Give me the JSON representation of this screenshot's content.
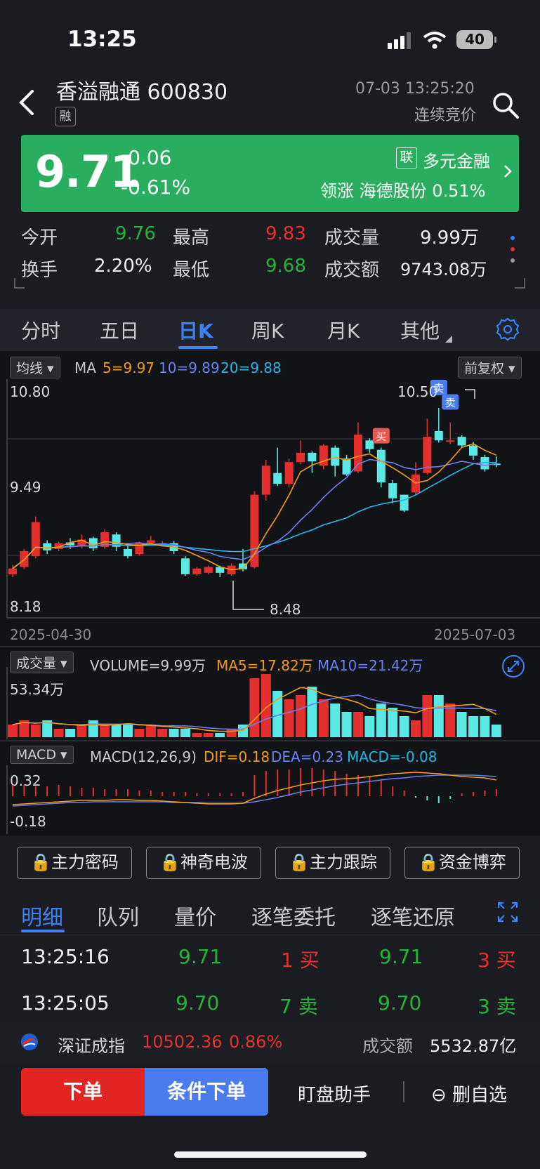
{
  "status_bar": {
    "time": "13:25",
    "battery": "40"
  },
  "header": {
    "stock_title": "香溢融通 600830",
    "margin_badge": "融",
    "datetime": "07-03 13:25:20",
    "trading_status": "连续竞价"
  },
  "quote": {
    "price": "9.71",
    "change": "-0.06",
    "change_pct": "-0.61%",
    "related_badge": "联",
    "related_sector": "多元金融",
    "leader_text": "领涨 海德股份 0.51%"
  },
  "stats": [
    {
      "label": "今开",
      "value": "9.76",
      "color": "green"
    },
    {
      "label": "最高",
      "value": "9.83",
      "color": "red"
    },
    {
      "label": "成交量",
      "value": "9.99万",
      "color": "white"
    },
    {
      "label": "换手",
      "value": "2.20%",
      "color": "white"
    },
    {
      "label": "最低",
      "value": "9.68",
      "color": "green"
    },
    {
      "label": "成交额",
      "value": "9743.08万",
      "color": "white"
    }
  ],
  "period_tabs": [
    "分时",
    "五日",
    "日K",
    "周K",
    "月K",
    "其他"
  ],
  "active_period": "日K",
  "kline": {
    "ma_button": "均线",
    "ma_label": "MA",
    "ma5": "5=9.97",
    "ma10": "10=9.89",
    "ma20": "20=9.88",
    "adjust_button": "前复权",
    "y_high": "10.80",
    "y_mid": "9.49",
    "y_low": "8.18",
    "max_label": "10.50",
    "min_label": "8.48",
    "start_date": "2025-04-30",
    "end_date": "2025-07-03",
    "signals": {
      "buy": "买",
      "sell": "卖"
    }
  },
  "volume": {
    "button": "成交量",
    "label": "VOLUME=9.99万",
    "ma5": "MA5=17.82万",
    "ma10": "MA10=21.42万",
    "y_max": "53.34万"
  },
  "macd": {
    "button": "MACD",
    "params": "MACD(12,26,9)",
    "dif": "DIF=0.18",
    "dea": "DEA=0.23",
    "macd": "MACD=-0.08",
    "y_top": "0.32",
    "y_bottom": "-0.18"
  },
  "colors": {
    "up": "#e3302f",
    "down": "#59e8e4",
    "ma5": "#f39c12",
    "ma10": "#6a7ff0",
    "ma20": "#22b8e6",
    "accent": "#3b82f6"
  },
  "chart_data": {
    "type": "candlestick",
    "x_range": [
      "2025-04-30",
      "2025-07-03"
    ],
    "ylim": [
      8.18,
      10.8
    ],
    "candles": [
      {
        "o": 8.2,
        "c": 8.28,
        "h": 8.33,
        "l": 8.16
      },
      {
        "o": 8.3,
        "c": 8.52,
        "h": 8.55,
        "l": 8.27
      },
      {
        "o": 8.45,
        "c": 8.92,
        "h": 9.0,
        "l": 8.42
      },
      {
        "o": 8.63,
        "c": 8.53,
        "h": 8.67,
        "l": 8.48
      },
      {
        "o": 8.55,
        "c": 8.63,
        "h": 8.65,
        "l": 8.52
      },
      {
        "o": 8.64,
        "c": 8.6,
        "h": 8.7,
        "l": 8.55
      },
      {
        "o": 8.6,
        "c": 8.68,
        "h": 8.75,
        "l": 8.56
      },
      {
        "o": 8.7,
        "c": 8.56,
        "h": 8.72,
        "l": 8.52
      },
      {
        "o": 8.58,
        "c": 8.78,
        "h": 8.82,
        "l": 8.55
      },
      {
        "o": 8.75,
        "c": 8.58,
        "h": 8.78,
        "l": 8.52
      },
      {
        "o": 8.55,
        "c": 8.45,
        "h": 8.6,
        "l": 8.42
      },
      {
        "o": 8.48,
        "c": 8.63,
        "h": 8.65,
        "l": 8.46
      },
      {
        "o": 8.63,
        "c": 8.67,
        "h": 8.73,
        "l": 8.6
      },
      {
        "o": 8.63,
        "c": 8.63,
        "h": 8.66,
        "l": 8.6
      },
      {
        "o": 8.63,
        "c": 8.52,
        "h": 8.66,
        "l": 8.48
      },
      {
        "o": 8.42,
        "c": 8.2,
        "h": 8.45,
        "l": 8.18
      },
      {
        "o": 8.2,
        "c": 8.28,
        "h": 8.3,
        "l": 8.18
      },
      {
        "o": 8.22,
        "c": 8.3,
        "h": 8.32,
        "l": 8.2
      },
      {
        "o": 8.3,
        "c": 8.22,
        "h": 8.32,
        "l": 8.16
      },
      {
        "o": 8.2,
        "c": 8.32,
        "h": 8.35,
        "l": 8.18
      },
      {
        "o": 8.35,
        "c": 8.27,
        "h": 8.55,
        "l": 8.24
      },
      {
        "o": 8.3,
        "c": 9.3,
        "h": 9.35,
        "l": 8.28
      },
      {
        "o": 9.3,
        "c": 9.7,
        "h": 9.78,
        "l": 9.22
      },
      {
        "o": 9.6,
        "c": 9.45,
        "h": 9.95,
        "l": 9.42
      },
      {
        "o": 9.45,
        "c": 9.75,
        "h": 9.8,
        "l": 9.4
      },
      {
        "o": 9.75,
        "c": 9.88,
        "h": 10.05,
        "l": 9.72
      },
      {
        "o": 9.88,
        "c": 9.76,
        "h": 9.9,
        "l": 9.6
      },
      {
        "o": 9.7,
        "c": 9.98,
        "h": 10.0,
        "l": 9.65
      },
      {
        "o": 9.95,
        "c": 9.7,
        "h": 9.98,
        "l": 9.55
      },
      {
        "o": 9.8,
        "c": 9.58,
        "h": 9.85,
        "l": 9.56
      },
      {
        "o": 9.62,
        "c": 10.13,
        "h": 10.3,
        "l": 9.6
      },
      {
        "o": 10.05,
        "c": 9.93,
        "h": 10.08,
        "l": 9.88
      },
      {
        "o": 9.92,
        "c": 9.47,
        "h": 9.95,
        "l": 9.4
      },
      {
        "o": 9.46,
        "c": 9.25,
        "h": 9.5,
        "l": 9.18
      },
      {
        "o": 9.3,
        "c": 9.08,
        "h": 9.3,
        "l": 9.06
      },
      {
        "o": 9.33,
        "c": 9.58,
        "h": 9.75,
        "l": 9.3
      },
      {
        "o": 9.6,
        "c": 10.1,
        "h": 10.35,
        "l": 9.58
      },
      {
        "o": 10.18,
        "c": 10.05,
        "h": 10.5,
        "l": 10.02
      },
      {
        "o": 10.05,
        "c": 10.05,
        "h": 10.3,
        "l": 10.0
      },
      {
        "o": 10.1,
        "c": 9.98,
        "h": 10.12,
        "l": 9.95
      },
      {
        "o": 9.98,
        "c": 9.84,
        "h": 10.03,
        "l": 9.78
      },
      {
        "o": 9.82,
        "c": 9.65,
        "h": 9.85,
        "l": 9.62
      },
      {
        "o": 9.73,
        "c": 9.71,
        "h": 9.83,
        "l": 9.68
      }
    ],
    "signals": [
      {
        "index": 32,
        "type": "买"
      },
      {
        "index": 37,
        "type": "卖"
      },
      {
        "index": 38,
        "type": "卖"
      }
    ]
  },
  "feature_buttons": [
    "主力密码",
    "神奇电波",
    "主力跟踪",
    "资金博弈"
  ],
  "detail_tabs": [
    "明细",
    "队列",
    "量价",
    "逐笔委托",
    "逐笔还原"
  ],
  "ticks": [
    {
      "time": "13:25:16",
      "price": "9.71",
      "vol": "1 买",
      "price2": "9.71",
      "vol2": "3 买"
    },
    {
      "time": "13:25:05",
      "price": "9.70",
      "vol": "7 卖",
      "price2": "9.70",
      "vol2": "3 卖"
    }
  ],
  "index_bar": {
    "name": "深证成指",
    "value": "10502.36",
    "pct": "0.86%",
    "amount_label": "成交额",
    "amount": "5532.87亿"
  },
  "bottom": {
    "order": "下单",
    "cond_order": "条件下单",
    "assistant": "盯盘助手",
    "remove": "删自选"
  }
}
